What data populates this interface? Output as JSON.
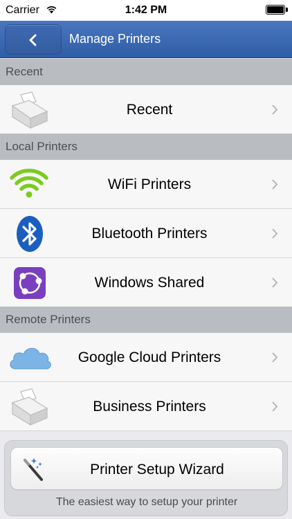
{
  "status_bar": {
    "carrier": "Carrier",
    "time": "1:42 PM"
  },
  "nav": {
    "title": "Manage Printers",
    "back_icon": "chevron-left-icon"
  },
  "sections": {
    "recent": {
      "header": "Recent",
      "rows": [
        {
          "label": "Recent",
          "icon": "printer-icon"
        }
      ]
    },
    "local": {
      "header": "Local Printers",
      "rows": [
        {
          "label": "WiFi Printers",
          "icon": "wifi-icon"
        },
        {
          "label": "Bluetooth Printers",
          "icon": "bluetooth-icon"
        },
        {
          "label": "Windows Shared",
          "icon": "network-share-icon"
        }
      ]
    },
    "remote": {
      "header": "Remote Printers",
      "rows": [
        {
          "label": "Google Cloud Printers",
          "icon": "cloud-icon"
        },
        {
          "label": "Business Printers",
          "icon": "printer-icon"
        }
      ]
    }
  },
  "wizard": {
    "label": "Printer Setup Wizard",
    "subtitle": "The easiest way to setup your printer",
    "icon": "magic-wand-icon"
  },
  "colors": {
    "nav_bar": "#3a67b1",
    "section_header": "#b9bcc1",
    "wifi_green": "#7ccb1f",
    "bluetooth_blue": "#1a5fc0",
    "windows_purple": "#7a3fbf",
    "cloud_blue": "#7db4e6"
  }
}
